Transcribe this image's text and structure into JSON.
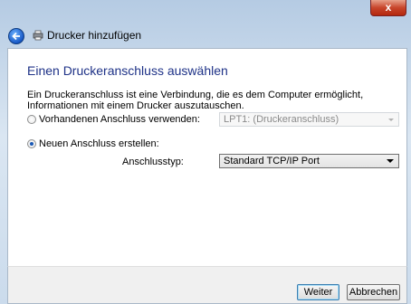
{
  "window": {
    "title": "Drucker hinzufügen",
    "close_label": "x"
  },
  "page": {
    "heading": "Einen Druckeranschluss auswählen",
    "description": "Ein Druckeranschluss ist eine Verbindung, die es dem Computer ermöglicht, Informationen mit einem Drucker auszutauschen."
  },
  "options": {
    "existing": {
      "label": "Vorhandenen Anschluss verwenden:",
      "selected": false,
      "value": "LPT1: (Druckeranschluss)"
    },
    "new": {
      "label": "Neuen Anschluss erstellen:",
      "selected": true
    },
    "port_type": {
      "label": "Anschlusstyp:",
      "value": "Standard TCP/IP Port"
    }
  },
  "buttons": {
    "next": "Weiter",
    "cancel": "Abbrechen"
  },
  "colors": {
    "heading": "#1e3287",
    "accent": "#1a59b5"
  }
}
